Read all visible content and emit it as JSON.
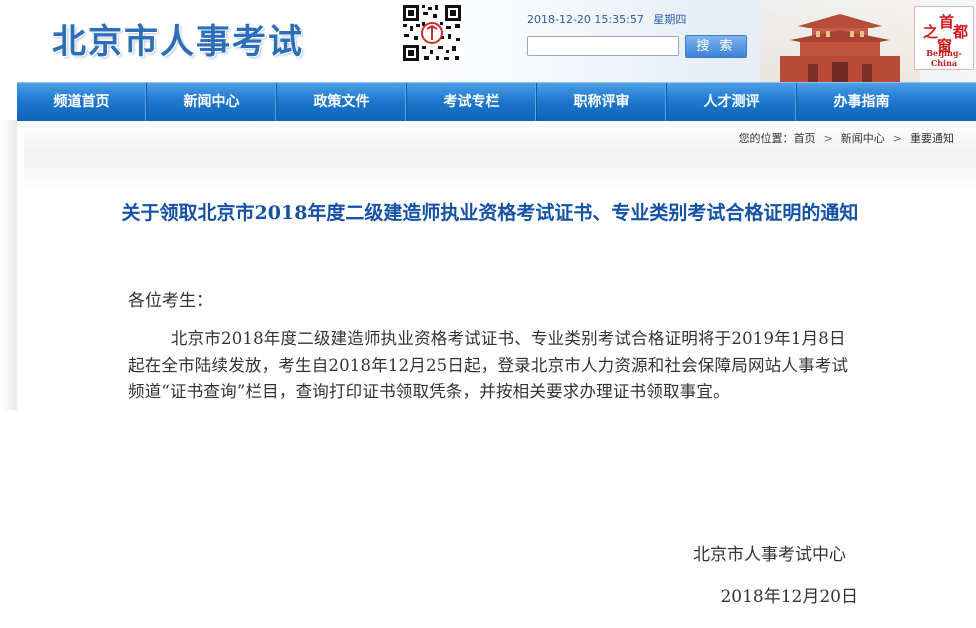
{
  "header": {
    "site_title": "北京市人事考试",
    "datetime": "2018-12-20 15:35:57",
    "weekday": "星期四",
    "search_placeholder": "",
    "search_button": "搜 索",
    "logo_chars": [
      "首",
      "都",
      "之",
      "窗"
    ],
    "logo_en": "Beijing-China"
  },
  "nav": {
    "items": [
      {
        "label": "频道首页"
      },
      {
        "label": "新闻中心"
      },
      {
        "label": "政策文件"
      },
      {
        "label": "考试专栏"
      },
      {
        "label": "职称评审"
      },
      {
        "label": "人才测评"
      },
      {
        "label": "办事指南"
      }
    ]
  },
  "breadcrumb": {
    "prefix": "您的位置：",
    "items": [
      "首页",
      "新闻中心",
      "重要通知"
    ],
    "separator": ">"
  },
  "article": {
    "title": "关于领取北京市2018年度二级建造师执业资格考试证书、专业类别考试合格证明的通知",
    "greeting": "各位考生：",
    "body": "北京市2018年度二级建造师执业资格考试证书、专业类别考试合格证明将于2019年1月8日起在全市陆续发放，考生自2018年12月25日起，登录北京市人力资源和社会保障局网站人事考试频道“证书查询”栏目，查询打印证书领取凭条，并按相关要求办理证书领取事宜。",
    "signature": "北京市人事考试中心",
    "date": "2018年12月20日"
  },
  "colors": {
    "brand_blue": "#2c6fb8",
    "nav_blue": "#1f79cf",
    "title_blue": "#1552a5",
    "logo_red": "#d11b1b"
  }
}
